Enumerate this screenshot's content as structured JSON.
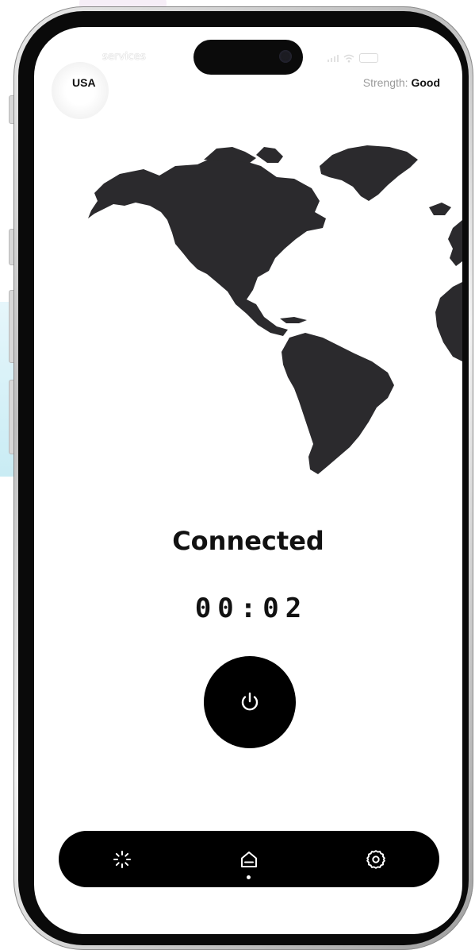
{
  "status_bar": {
    "carrier": "services"
  },
  "header": {
    "country": "USA",
    "strength_label": "Strength:",
    "strength_value": "Good"
  },
  "connection": {
    "status": "Connected",
    "timer": "00:02"
  },
  "power": {
    "icon": "power-icon"
  },
  "nav": {
    "items": [
      {
        "icon": "loading-icon",
        "active": false
      },
      {
        "icon": "home-icon",
        "active": true
      },
      {
        "icon": "settings-icon",
        "active": false
      }
    ]
  },
  "colors": {
    "primary": "#000000",
    "background": "#ffffff",
    "map": "#2b2a2d",
    "muted_text": "#9a9a9a"
  }
}
